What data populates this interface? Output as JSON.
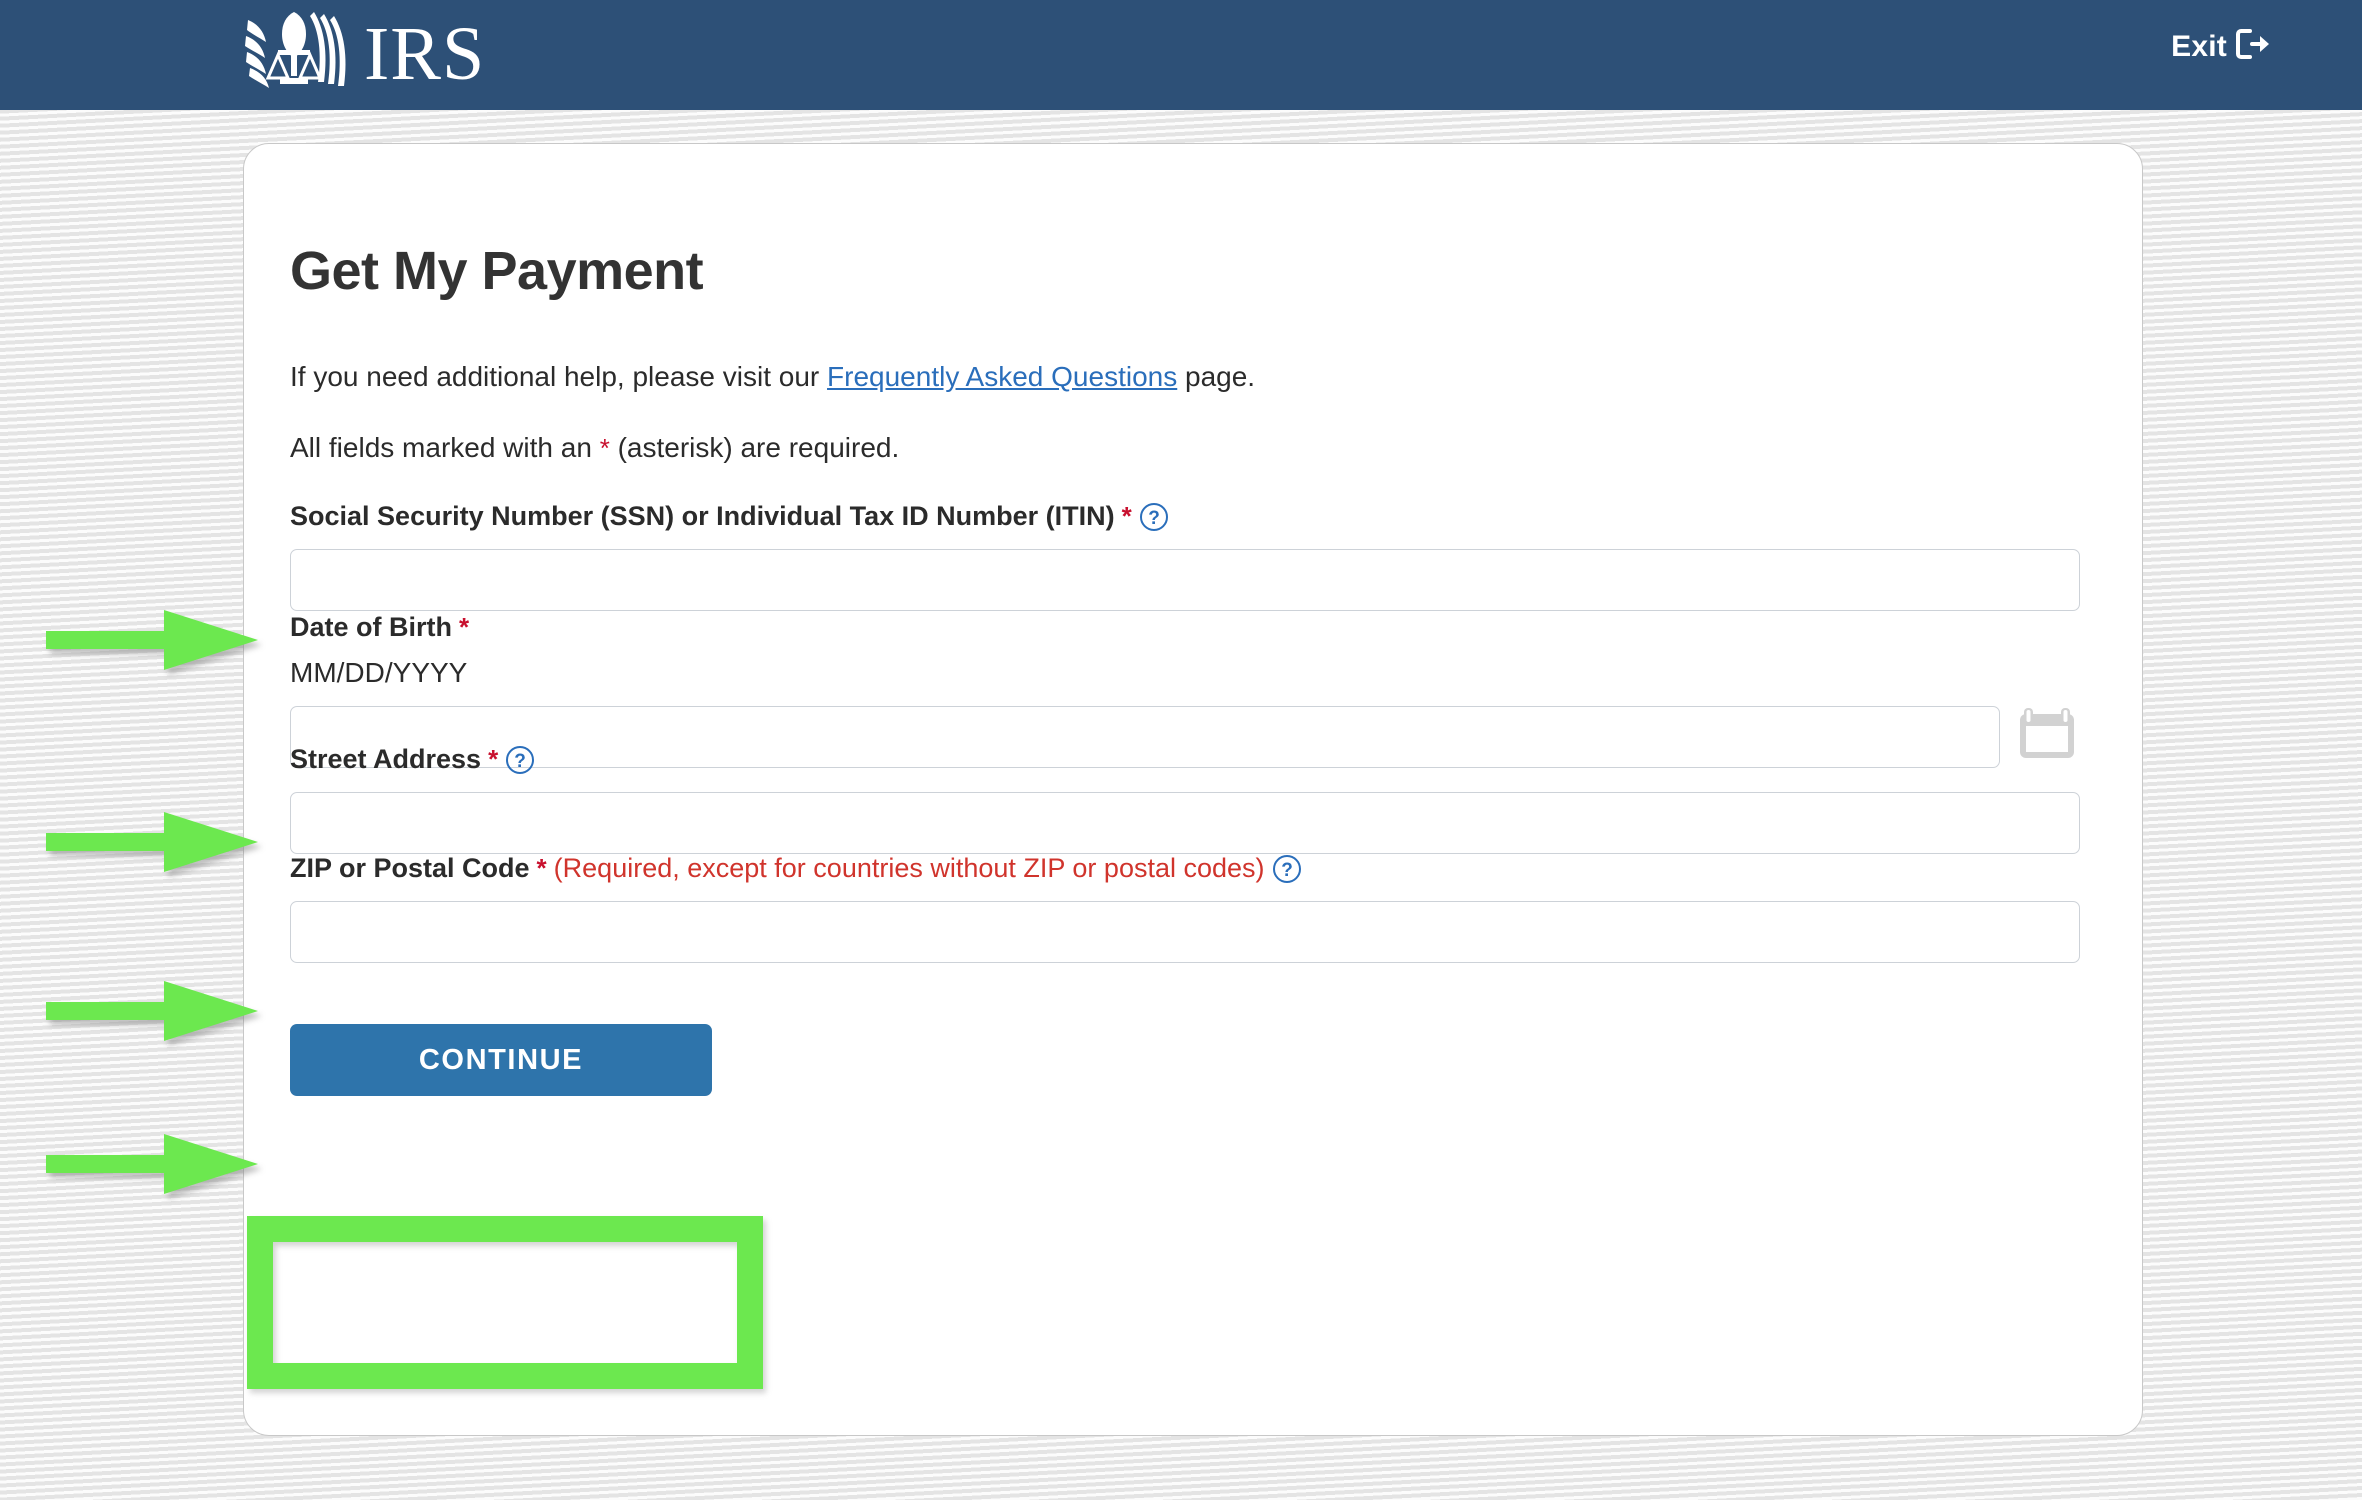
{
  "header": {
    "logo_text": "IRS",
    "logo_icon": "irs-eagle-seal-icon",
    "exit_label": "Exit",
    "exit_icon": "sign-out-icon",
    "background_color": "#2d5077"
  },
  "card": {
    "title": "Get My Payment",
    "help_text_before_link": "If you need additional help, please visit our ",
    "help_link_text": "Frequently Asked Questions",
    "help_text_after_link": " page.",
    "required_text_before": "All fields marked with an ",
    "required_asterisk": "*",
    "required_text_after": " (asterisk) are required."
  },
  "fields": {
    "ssn": {
      "label": "Social Security Number (SSN) or Individual Tax ID Number (ITIN)",
      "asterisk": "*",
      "help_icon": "question-mark-circle-icon",
      "value": "",
      "placeholder": ""
    },
    "dob": {
      "label": "Date of Birth",
      "asterisk": "*",
      "format_hint": "MM/DD/YYYY",
      "value": "",
      "placeholder": "",
      "calendar_icon": "calendar-icon"
    },
    "street": {
      "label": "Street Address",
      "asterisk": "*",
      "help_icon": "question-mark-circle-icon",
      "value": "",
      "placeholder": ""
    },
    "zip": {
      "label": "ZIP or Postal Code",
      "asterisk": "*",
      "note": "(Required, except for countries without ZIP or postal codes)",
      "help_icon": "question-mark-circle-icon",
      "value": "",
      "placeholder": ""
    }
  },
  "actions": {
    "continue_label": "CONTINUE",
    "continue_color": "#2e74ab"
  },
  "annotations": {
    "color": "#6ce84f",
    "arrow_count": 4,
    "highlight_target": "continue-button"
  },
  "colors": {
    "header_navy": "#2d5077",
    "link_blue": "#2a6ebb",
    "required_red": "#c8102e",
    "note_red": "#d0342c",
    "annotation_green": "#6ce84f",
    "page_background": "#ebebeb"
  }
}
